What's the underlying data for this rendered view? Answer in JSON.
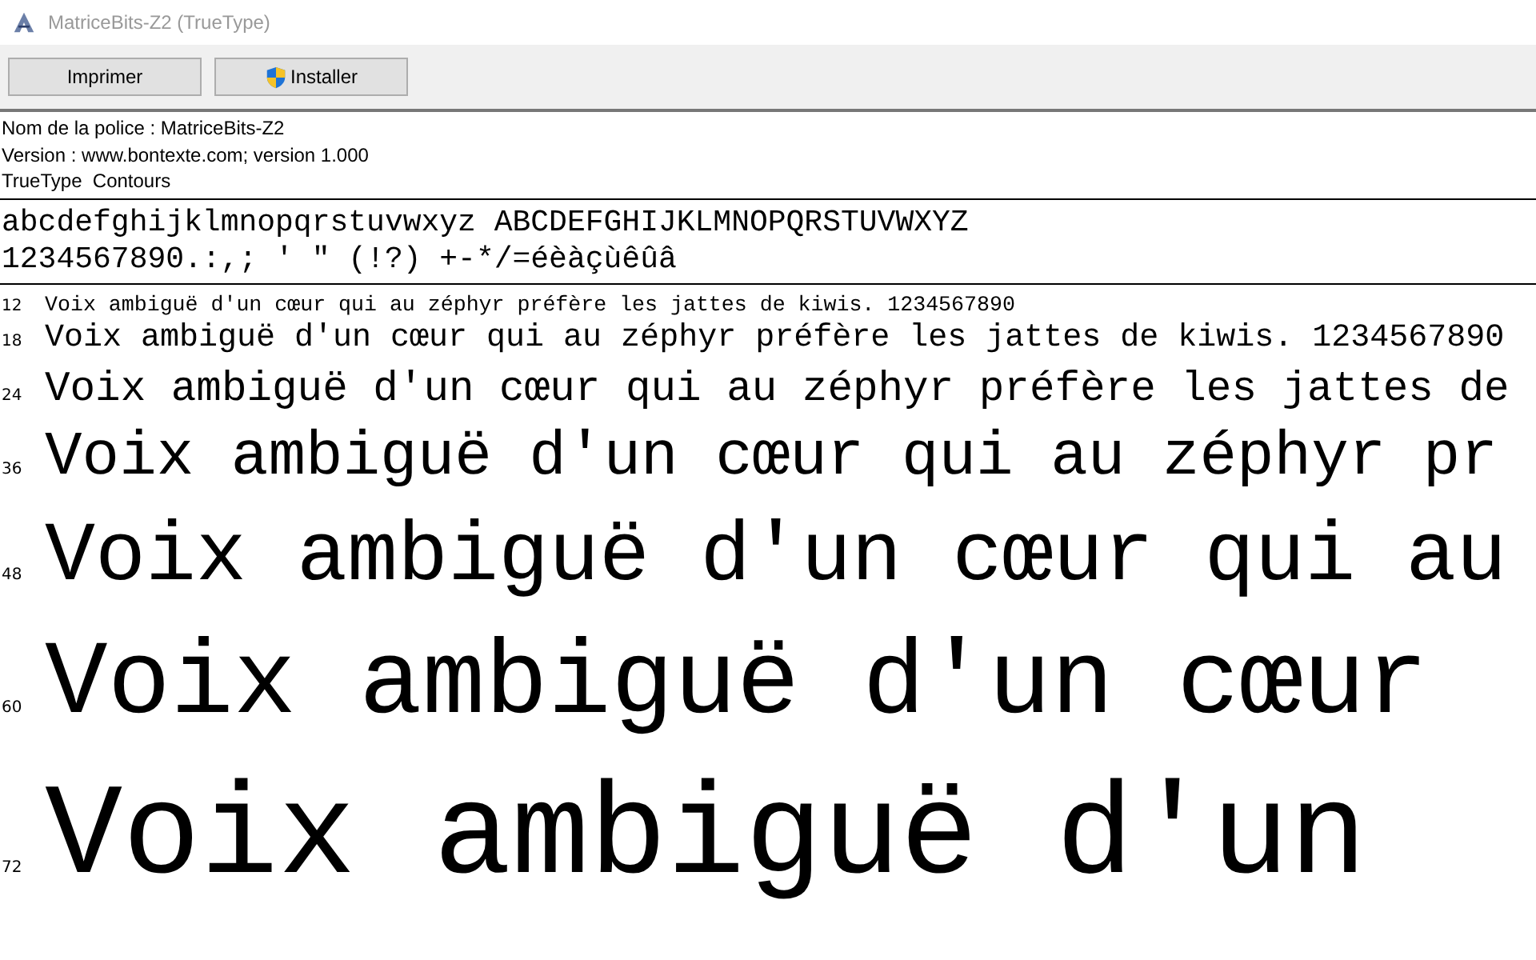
{
  "window": {
    "title": "MatriceBits-Z2 (TrueType)"
  },
  "toolbar": [
    {
      "label": "Imprimer",
      "kind": "plain"
    },
    {
      "label": "Installer",
      "kind": "shield"
    }
  ],
  "info": [
    "Nom de la police : MatriceBits-Z2",
    "Version : www.bontexte.com; version 1.000",
    "TrueType  Contours"
  ],
  "charset": [
    "abcdefghijklmnopqrstuvwxyz ABCDEFGHIJKLMNOPQRSTUVWXYZ",
    "1234567890.:,; ' \" (!?) +-*/=éèàçùêûâ"
  ],
  "samples": [
    {
      "size": "12",
      "text": "Voix ambiguë d'un cœur qui au zéphyr préfère les jattes de kiwis. 1234567890"
    },
    {
      "size": "18",
      "text": "Voix ambiguë d'un cœur qui au zéphyr préfère les jattes de kiwis. 1234567890"
    },
    {
      "size": "24",
      "text": "Voix ambiguë d'un cœur qui au zéphyr préfère les jattes de"
    },
    {
      "size": "36",
      "text": "Voix ambiguë d'un cœur qui au zéphyr pr"
    },
    {
      "size": "48",
      "text": "Voix ambiguë d'un cœur qui au"
    },
    {
      "size": "60",
      "text": "Voix ambiguë d'un cœur"
    },
    {
      "size": "72",
      "text": "Voix ambiguë d'un"
    }
  ]
}
